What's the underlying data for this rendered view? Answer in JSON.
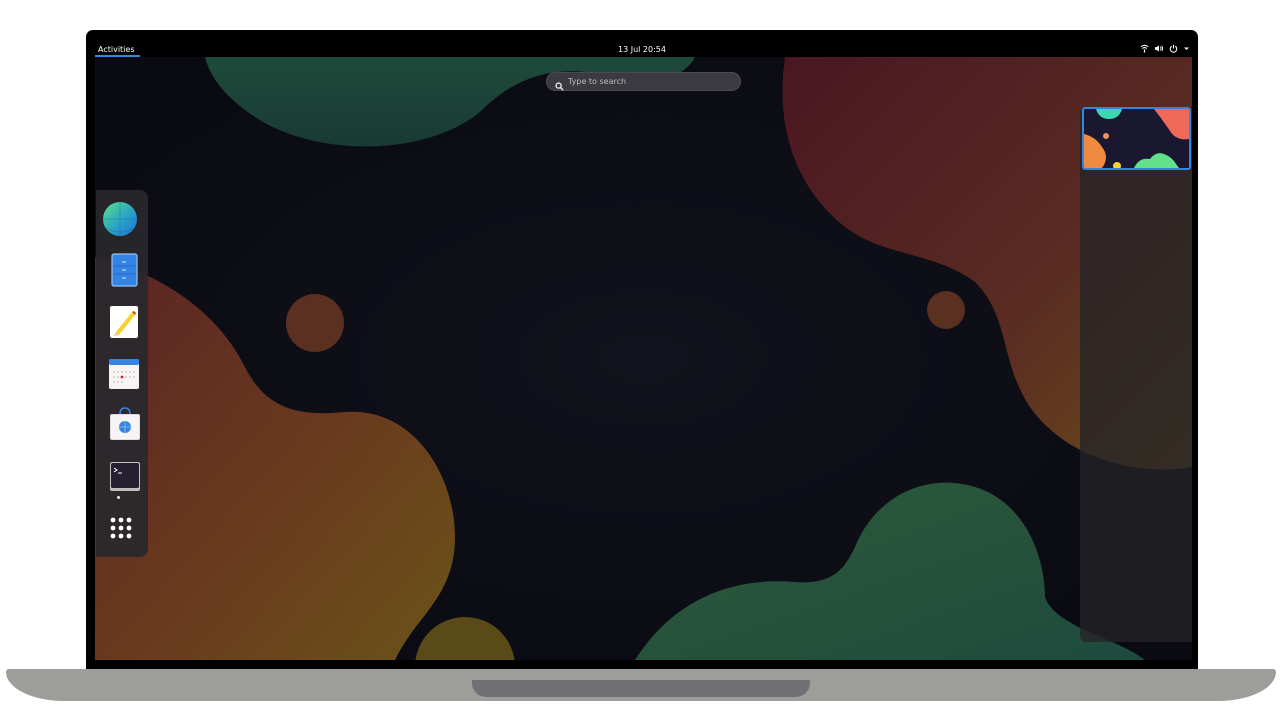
{
  "topbar": {
    "activities_label": "Activities",
    "clock": "13 Jul 20:54",
    "tray_icons": [
      "network-icon",
      "volume-icon",
      "power-icon",
      "chevron-down-icon"
    ]
  },
  "search": {
    "placeholder": "Type to search"
  },
  "dash": {
    "items": [
      {
        "name": "web-browser",
        "icon": "globe-icon"
      },
      {
        "name": "files",
        "icon": "file-cabinet-icon"
      },
      {
        "name": "text-editor",
        "icon": "pencil-icon"
      },
      {
        "name": "calendar",
        "icon": "calendar-icon"
      },
      {
        "name": "software",
        "icon": "shopping-bag-icon"
      },
      {
        "name": "terminal",
        "icon": "terminal-icon",
        "running": true
      },
      {
        "name": "show-applications",
        "icon": "app-grid-icon"
      }
    ]
  },
  "workspaces": {
    "count": 1,
    "active_index": 0
  },
  "colors": {
    "accent": "#3584e4",
    "topbar": "#000000",
    "wallpaper_bg": "#0d0c16"
  }
}
